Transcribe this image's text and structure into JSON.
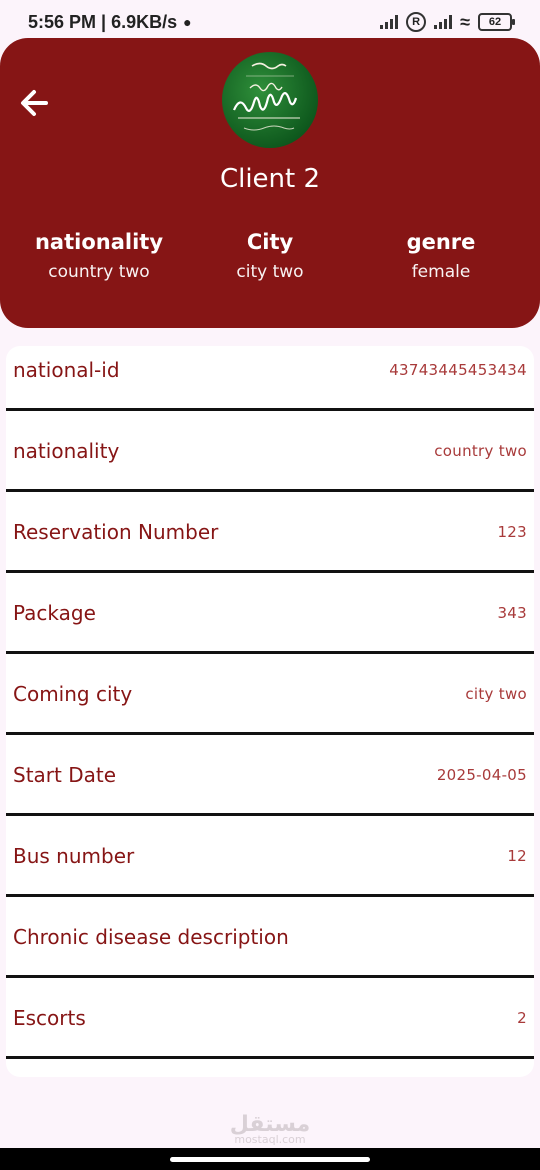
{
  "status_bar": {
    "time_speed": "5:56 PM | 6.9KB/s",
    "battery": "62",
    "r_badge": "R"
  },
  "header": {
    "client_name": "Client 2",
    "stats": [
      {
        "title": "nationality",
        "value": "country two"
      },
      {
        "title": "City",
        "value": "city two"
      },
      {
        "title": "genre",
        "value": "female"
      }
    ]
  },
  "details": [
    {
      "label": "national-id",
      "value": "43743445453434"
    },
    {
      "label": "nationality",
      "value": "country two"
    },
    {
      "label": "Reservation Number",
      "value": "123"
    },
    {
      "label": "Package",
      "value": "343"
    },
    {
      "label": "Coming city",
      "value": "city two"
    },
    {
      "label": "Start Date",
      "value": "2025-04-05"
    },
    {
      "label": "Bus number",
      "value": "12"
    },
    {
      "label": "Chronic disease description",
      "value": ""
    },
    {
      "label": "Escorts",
      "value": "2"
    }
  ],
  "watermark": {
    "main": "مستقل",
    "sub": "mostaql.com"
  },
  "colors": {
    "primary": "#861515",
    "value_text": "#a83a3a",
    "background": "#fcf4fb"
  }
}
